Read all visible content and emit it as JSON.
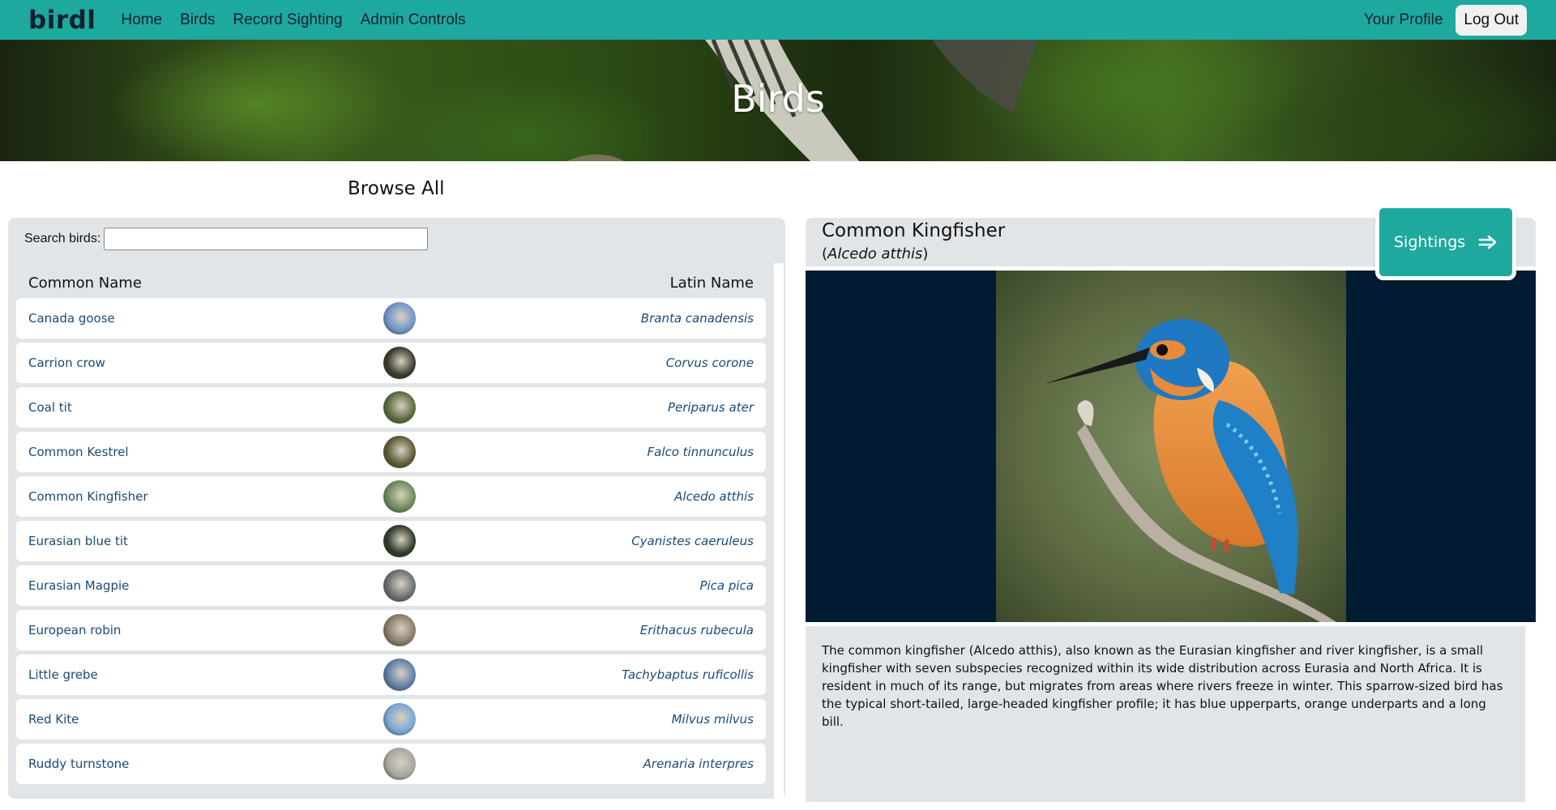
{
  "nav": {
    "brand": "birdl",
    "links": [
      "Home",
      "Birds",
      "Record Sighting",
      "Admin Controls"
    ],
    "profile": "Your Profile",
    "logout": "Log Out"
  },
  "hero": {
    "title": "Birds"
  },
  "browse": {
    "title": "Browse All",
    "search_label": "Search birds:",
    "search_value": "",
    "header_common": "Common Name",
    "header_latin": "Latin Name",
    "birds": [
      {
        "common": "Canada goose",
        "latin": "Branta canadensis",
        "thumb": "#6f94c8"
      },
      {
        "common": "Carrion crow",
        "latin": "Corvus corone",
        "thumb": "#3b3a2c"
      },
      {
        "common": "Coal tit",
        "latin": "Periparus ater",
        "thumb": "#5a6a3c"
      },
      {
        "common": "Common Kestrel",
        "latin": "Falco tinnunculus",
        "thumb": "#5c5a36"
      },
      {
        "common": "Common Kingfisher",
        "latin": "Alcedo atthis",
        "thumb": "#6b8a5a"
      },
      {
        "common": "Eurasian blue tit",
        "latin": "Cyanistes caeruleus",
        "thumb": "#2f3a2a"
      },
      {
        "common": "Eurasian Magpie",
        "latin": "Pica pica",
        "thumb": "#6a6e70"
      },
      {
        "common": "European robin",
        "latin": "Erithacus rubecula",
        "thumb": "#8a7a6a"
      },
      {
        "common": "Little grebe",
        "latin": "Tachybaptus ruficollis",
        "thumb": "#5e7ea8"
      },
      {
        "common": "Red Kite",
        "latin": "Milvus milvus",
        "thumb": "#7aa6d4"
      },
      {
        "common": "Ruddy turnstone",
        "latin": "Arenaria interpres",
        "thumb": "#a9a5a0"
      }
    ]
  },
  "detail": {
    "name": "Common Kingfisher",
    "latin": "Alcedo atthis",
    "description": "The common kingfisher (Alcedo atthis), also known as the Eurasian kingfisher and river kingfisher, is a small kingfisher with seven subspecies recognized within its wide distribution across Eurasia and North Africa. It is resident in much of its range, but migrates from areas where rivers freeze in winter. This sparrow-sized bird has the typical short-tailed, large-headed kingfisher profile; it has blue upperparts, orange underparts and a long bill.",
    "sightings_button": "Sightings"
  },
  "colors": {
    "brand_teal": "#1ea99f",
    "link_blue": "#1a4a7a",
    "panel_grey": "#e2e5e8",
    "image_bg": "#011b33"
  }
}
